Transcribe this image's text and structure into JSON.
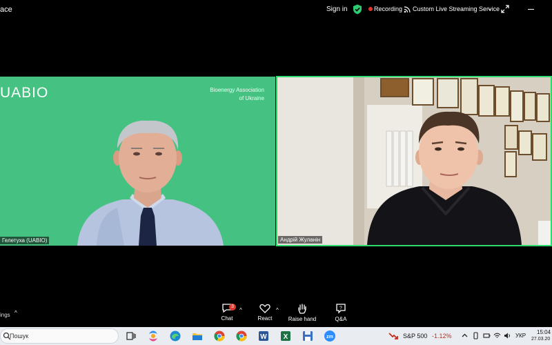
{
  "window": {
    "title_fragment": "ace",
    "sign_in": "Sign in",
    "recording": "Recording",
    "streaming": "Custom Live Streaming Service"
  },
  "participants": [
    {
      "name": "Гелетуха (UABIO)",
      "logo": "UABIO",
      "org_line1": "Bioenergy Association",
      "org_line2": "of Ukraine",
      "background": "#45c282"
    },
    {
      "name": "Андрій Жуланін",
      "active_speaker": true,
      "highlight_color": "#2ddc6d"
    }
  ],
  "toolbar": {
    "settings_label": "ings",
    "chat_label": "Chat",
    "chat_badge": "3",
    "react_label": "React",
    "raise_hand_label": "Raise hand",
    "qa_label": "Q&A"
  },
  "taskbar": {
    "search_placeholder": "Пошук",
    "apps": [
      "copilot",
      "edge",
      "file-explorer",
      "chrome",
      "chrome-2",
      "word",
      "excel",
      "save",
      "zoom"
    ],
    "ticker_name": "S&P 500",
    "ticker_change": "-1.12%",
    "language": "УКР",
    "time": "15:04",
    "date": "27.03.20"
  },
  "colors": {
    "recording_dot": "#e0362b",
    "badge": "#e0362b",
    "ticker_negative": "#c42b1c",
    "shield": "#2ecc71"
  }
}
